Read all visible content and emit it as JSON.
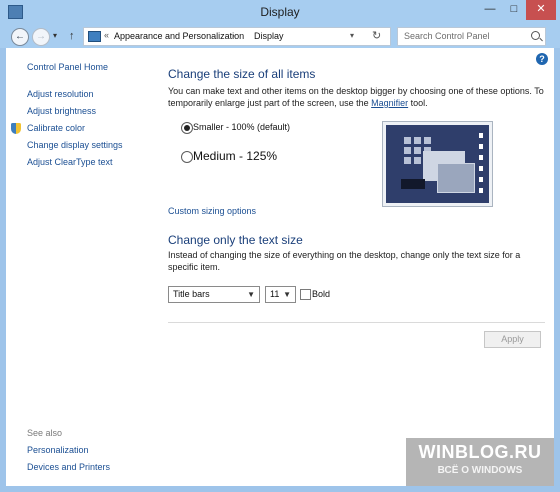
{
  "window": {
    "title": "Display",
    "minimize": "—",
    "maximize": "□",
    "close": "✕"
  },
  "address": {
    "back": "←",
    "forward": "→",
    "recent": "▾",
    "up": "↑",
    "chevron": "«",
    "crumbs": [
      "Appearance and Personalization",
      "Display"
    ],
    "sep": "›",
    "dropdown": "▾",
    "refresh": "↻",
    "search_placeholder": "Search Control Panel"
  },
  "help": "?",
  "sidebar": {
    "home": "Control Panel Home",
    "items": [
      "Adjust resolution",
      "Adjust brightness",
      "Calibrate color",
      "Change display settings",
      "Adjust ClearType text"
    ],
    "see_also": "See also",
    "see_also_items": [
      "Personalization",
      "Devices and Printers"
    ]
  },
  "main": {
    "size_heading": "Change the size of all items",
    "size_desc_a": "You can make text and other items on the desktop bigger by choosing one of these options. To temporarily enlarge just part of the screen, use the ",
    "size_desc_link": "Magnifier",
    "size_desc_b": " tool.",
    "options": [
      "Smaller - 100% (default)",
      "Medium - 125%"
    ],
    "selected_option": 0,
    "custom_link": "Custom sizing options",
    "text_heading": "Change only the text size",
    "text_desc": "Instead of changing the size of everything on the desktop, change only the text size for a specific item.",
    "item_select": "Title bars",
    "size_select": "11",
    "bold_label": "Bold",
    "bold_checked": false,
    "apply": "Apply"
  },
  "watermark": {
    "line1": "WINBLOG.RU",
    "line2": "ВСЁ О WINDOWS"
  }
}
